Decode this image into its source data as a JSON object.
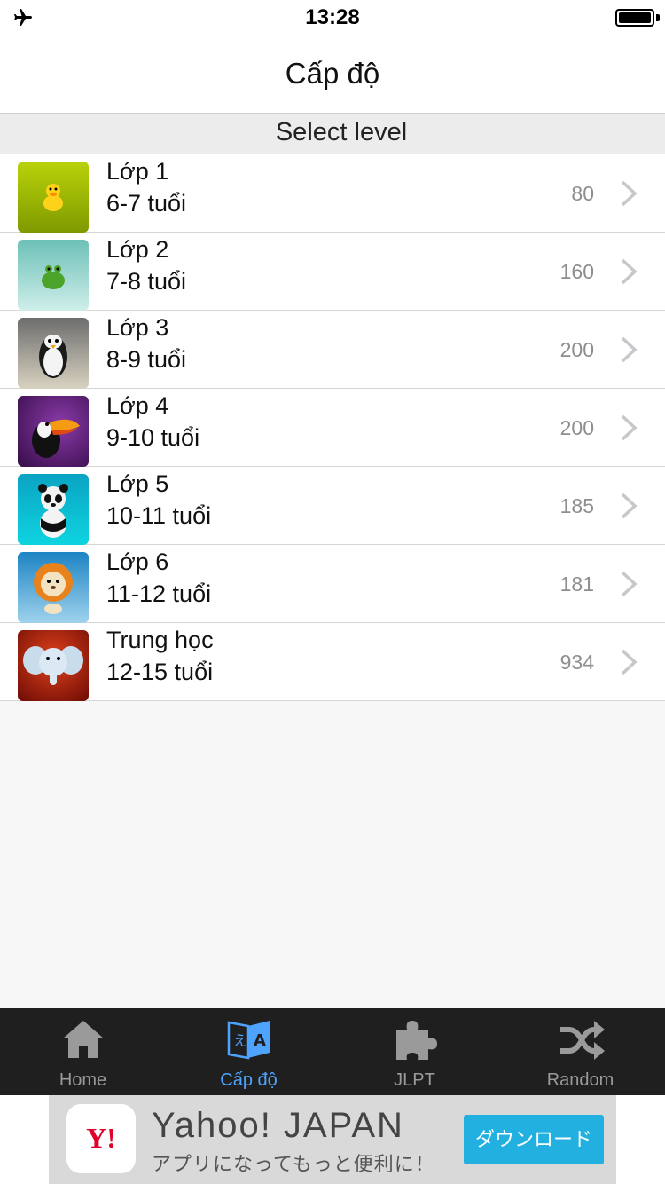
{
  "status": {
    "time": "13:28",
    "airplane_icon": "airplane-icon",
    "battery_icon": "battery-icon"
  },
  "nav": {
    "title": "Cấp độ"
  },
  "section": {
    "title": "Select level"
  },
  "levels": [
    {
      "name": "Lớp 1",
      "ages": "6-7 tuổi",
      "count": "80",
      "icon": "duck-icon"
    },
    {
      "name": "Lớp 2",
      "ages": "7-8 tuổi",
      "count": "160",
      "icon": "frog-icon"
    },
    {
      "name": "Lớp 3",
      "ages": "8-9 tuổi",
      "count": "200",
      "icon": "penguin-icon"
    },
    {
      "name": "Lớp 4",
      "ages": "9-10 tuổi",
      "count": "200",
      "icon": "toucan-icon"
    },
    {
      "name": "Lớp 5",
      "ages": "10-11 tuổi",
      "count": "185",
      "icon": "panda-icon"
    },
    {
      "name": "Lớp 6",
      "ages": "11-12 tuổi",
      "count": "181",
      "icon": "lion-icon"
    },
    {
      "name": "Trung học",
      "ages": "12-15 tuổi",
      "count": "934",
      "icon": "elephant-icon"
    }
  ],
  "tabs": [
    {
      "label": "Home",
      "icon": "home-icon",
      "active": false
    },
    {
      "label": "Cấp độ",
      "icon": "translate-icon",
      "active": true
    },
    {
      "label": "JLPT",
      "icon": "puzzle-icon",
      "active": false
    },
    {
      "label": "Random",
      "icon": "shuffle-icon",
      "active": false
    }
  ],
  "ad": {
    "logo_text": "Y!",
    "title": "Yahoo! JAPAN",
    "subtitle": "アプリになってもっと便利に！",
    "button_label": "ダウンロード"
  },
  "colors": {
    "accent": "#4ea3ff",
    "tabbar": "#1f1f1f",
    "ad_button": "#22b0e0"
  }
}
